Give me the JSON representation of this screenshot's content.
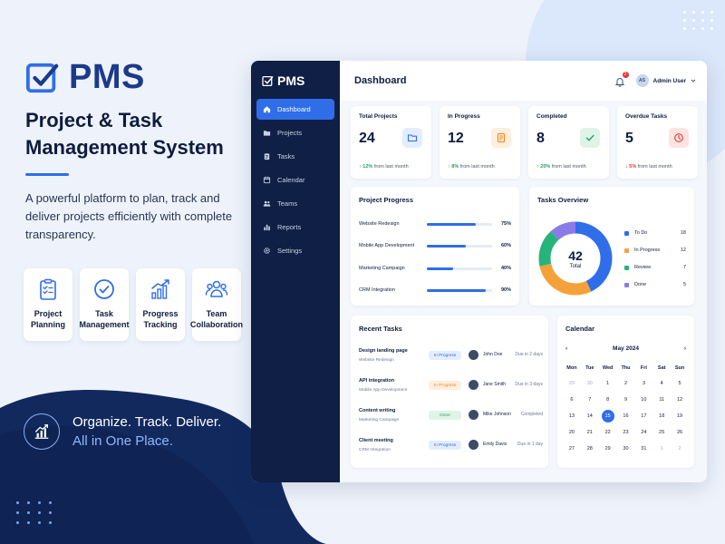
{
  "brand": {
    "name": "PMS"
  },
  "promo": {
    "headline_1": "Project & Task",
    "headline_2": "Management System",
    "tagline": "A powerful platform to plan, track and deliver projects efficiently with complete transparency.",
    "features": [
      {
        "label_1": "Project",
        "label_2": "Planning",
        "icon": "clipboard-checklist-icon"
      },
      {
        "label_1": "Task",
        "label_2": "Management",
        "icon": "check-circle-icon"
      },
      {
        "label_1": "Progress",
        "label_2": "Tracking",
        "icon": "bar-chart-up-icon"
      },
      {
        "label_1": "Team",
        "label_2": "Collaboration",
        "icon": "team-icon"
      }
    ],
    "slogan_1": "Organize. Track. Deliver.",
    "slogan_2": "All in One Place."
  },
  "sidebar": {
    "brand": "PMS",
    "items": [
      {
        "label": "Dashboard",
        "icon": "home-icon",
        "active": true
      },
      {
        "label": "Projects",
        "icon": "folder-icon"
      },
      {
        "label": "Tasks",
        "icon": "clipboard-icon"
      },
      {
        "label": "Calendar",
        "icon": "calendar-icon"
      },
      {
        "label": "Teams",
        "icon": "team-icon"
      },
      {
        "label": "Reports",
        "icon": "bar-chart-icon"
      },
      {
        "label": "Settings",
        "icon": "gear-icon"
      }
    ]
  },
  "header": {
    "title": "Dashboard",
    "notification_count": "3",
    "user_initials": "AS",
    "user_name": "Admin User"
  },
  "stats": [
    {
      "label": "Total Projects",
      "value": "24",
      "delta": "12%",
      "delta_text": "from last month",
      "direction": "up",
      "color": "#2f6ee8",
      "bg": "#e3edfd",
      "icon": "folder-icon"
    },
    {
      "label": "In Progress",
      "value": "12",
      "delta": "8%",
      "delta_text": "from last month",
      "direction": "up",
      "color": "#f08a24",
      "bg": "#fdeedd",
      "icon": "document-icon"
    },
    {
      "label": "Completed",
      "value": "8",
      "delta": "20%",
      "delta_text": "from last month",
      "direction": "up",
      "color": "#22a45d",
      "bg": "#dff4e7",
      "icon": "check-icon"
    },
    {
      "label": "Overdue Tasks",
      "value": "5",
      "delta": "5%",
      "delta_text": "from last month",
      "direction": "down",
      "color": "#e5372f",
      "bg": "#fde3e2",
      "icon": "clock-icon"
    }
  ],
  "project_progress": {
    "title": "Project Progress",
    "items": [
      {
        "name": "Website Redesign",
        "percent": 75,
        "label": "75%"
      },
      {
        "name": "Mobile App Development",
        "percent": 60,
        "label": "60%"
      },
      {
        "name": "Marketing Campaign",
        "percent": 40,
        "label": "40%"
      },
      {
        "name": "CRM Integration",
        "percent": 90,
        "label": "90%"
      }
    ]
  },
  "tasks_overview": {
    "title": "Tasks Overview",
    "total": "42",
    "total_label": "Total",
    "items": [
      {
        "name": "To Do",
        "value": 18,
        "label": "18",
        "color": "#2f6ee8"
      },
      {
        "name": "In Progress",
        "value": 12,
        "label": "12",
        "color": "#f5a13a"
      },
      {
        "name": "Review",
        "value": 7,
        "label": "7",
        "color": "#27b47a"
      },
      {
        "name": "Done",
        "value": 5,
        "label": "5",
        "color": "#8b7be8"
      }
    ]
  },
  "recent_tasks": {
    "title": "Recent Tasks",
    "rows": [
      {
        "name": "Design landing page",
        "project": "Website Redesign",
        "status": "In Progress",
        "status_color": "#2f6ee8",
        "status_bg": "#e3edfd",
        "assignee": "John Doe",
        "due": "Due in 2 days"
      },
      {
        "name": "API integration",
        "project": "Mobile App Development",
        "status": "In Progress",
        "status_color": "#f08a24",
        "status_bg": "#fdeedd",
        "assignee": "Jane Smith",
        "due": "Due in 3 days"
      },
      {
        "name": "Content writing",
        "project": "Marketing Campaign",
        "status": "Done",
        "status_color": "#22a45d",
        "status_bg": "#dff4e7",
        "assignee": "Mike Johnson",
        "due": "Completed"
      },
      {
        "name": "Client meeting",
        "project": "CRM Integration",
        "status": "In Progress",
        "status_color": "#2f6ee8",
        "status_bg": "#e3edfd",
        "assignee": "Emily Davis",
        "due": "Due in 1 day"
      }
    ]
  },
  "calendar": {
    "title": "Calendar",
    "month": "May 2024",
    "prev": "‹",
    "next": "›",
    "weekdays": [
      "Mon",
      "Tue",
      "Wed",
      "Thu",
      "Fri",
      "Sat",
      "Sun"
    ],
    "days": [
      {
        "d": "29",
        "muted": true
      },
      {
        "d": "30",
        "muted": true
      },
      {
        "d": "1"
      },
      {
        "d": "2"
      },
      {
        "d": "3"
      },
      {
        "d": "4"
      },
      {
        "d": "5"
      },
      {
        "d": "6"
      },
      {
        "d": "7"
      },
      {
        "d": "8"
      },
      {
        "d": "9"
      },
      {
        "d": "10"
      },
      {
        "d": "11"
      },
      {
        "d": "12"
      },
      {
        "d": "13"
      },
      {
        "d": "14"
      },
      {
        "d": "15",
        "today": true
      },
      {
        "d": "16"
      },
      {
        "d": "17"
      },
      {
        "d": "18"
      },
      {
        "d": "19"
      },
      {
        "d": "20"
      },
      {
        "d": "21"
      },
      {
        "d": "22"
      },
      {
        "d": "23"
      },
      {
        "d": "24"
      },
      {
        "d": "25"
      },
      {
        "d": "26"
      },
      {
        "d": "27"
      },
      {
        "d": "28"
      },
      {
        "d": "29"
      },
      {
        "d": "30"
      },
      {
        "d": "31"
      },
      {
        "d": "1",
        "muted": true
      },
      {
        "d": "2",
        "muted": true
      }
    ]
  }
}
